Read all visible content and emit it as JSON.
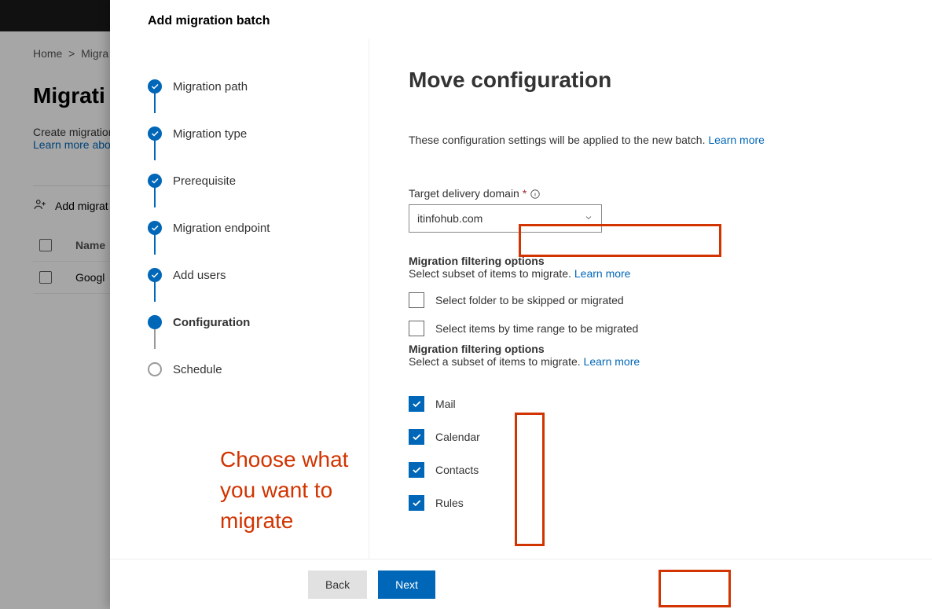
{
  "background": {
    "breadcrumb_home": "Home",
    "breadcrumb_sep": ">",
    "breadcrumb_current": "Migra",
    "heading": "Migrati",
    "sub_text": "Create migration",
    "sub_link": "Learn more abo",
    "toolbar_add": "Add migrat",
    "col_name": "Name",
    "row1_name": "Googl"
  },
  "panel": {
    "title": "Add migration batch"
  },
  "steps": [
    {
      "label": "Migration path",
      "state": "done"
    },
    {
      "label": "Migration type",
      "state": "done"
    },
    {
      "label": "Prerequisite",
      "state": "done"
    },
    {
      "label": "Migration endpoint",
      "state": "done"
    },
    {
      "label": "Add users",
      "state": "done"
    },
    {
      "label": "Configuration",
      "state": "current"
    },
    {
      "label": "Schedule",
      "state": "pending"
    }
  ],
  "content": {
    "heading": "Move configuration",
    "intro_text": "These configuration settings will be applied to the new batch. ",
    "learn_more": "Learn more",
    "domain_label": "Target delivery domain",
    "domain_value": "itinfohub.com",
    "filter1_head": "Migration filtering options",
    "filter1_sub": "Select subset of items to migrate. ",
    "filter1_opt_folder": "Select folder to be skipped or migrated",
    "filter1_opt_time": "Select items by time range to be migrated",
    "filter2_head": "Migration filtering options",
    "filter2_sub": "Select a subset of items to migrate. ",
    "items": [
      {
        "label": "Mail"
      },
      {
        "label": "Calendar"
      },
      {
        "label": "Contacts"
      },
      {
        "label": "Rules"
      }
    ]
  },
  "footer": {
    "back": "Back",
    "next": "Next"
  },
  "annotation": {
    "text_line1": "Choose what",
    "text_line2": "you want to",
    "text_line3": "migrate"
  }
}
